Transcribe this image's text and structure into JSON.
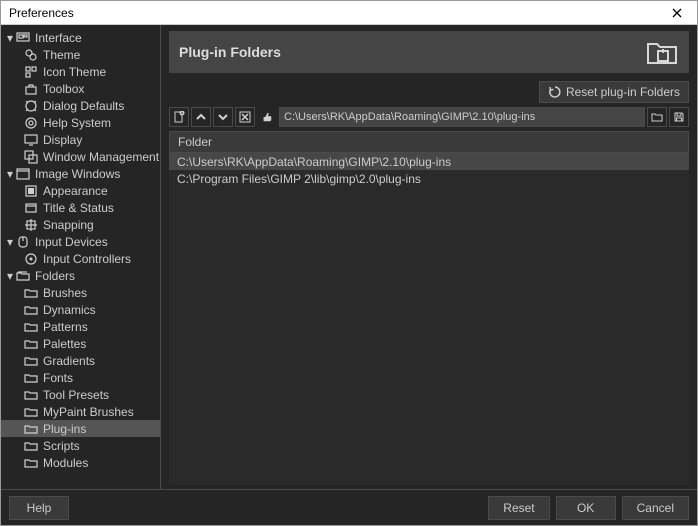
{
  "window": {
    "title": "Preferences"
  },
  "panel": {
    "title": "Plug-in Folders",
    "reset_plugin_folders": "Reset plug-in Folders"
  },
  "path_input": {
    "value": "C:\\Users\\RK\\AppData\\Roaming\\GIMP\\2.10\\plug-ins"
  },
  "folder_list": {
    "header": "Folder",
    "rows": [
      "C:\\Users\\RK\\AppData\\Roaming\\GIMP\\2.10\\plug-ins",
      "C:\\Program Files\\GIMP 2\\lib\\gimp\\2.0\\plug-ins"
    ],
    "selected": 0
  },
  "sidebar": {
    "items": [
      {
        "kind": "root",
        "label": "Interface",
        "icon": "interface",
        "expanded": true
      },
      {
        "kind": "child",
        "label": "Theme",
        "icon": "theme"
      },
      {
        "kind": "child",
        "label": "Icon Theme",
        "icon": "icon-theme"
      },
      {
        "kind": "child",
        "label": "Toolbox",
        "icon": "toolbox"
      },
      {
        "kind": "child",
        "label": "Dialog Defaults",
        "icon": "dialog-defaults"
      },
      {
        "kind": "child",
        "label": "Help System",
        "icon": "help"
      },
      {
        "kind": "child",
        "label": "Display",
        "icon": "display"
      },
      {
        "kind": "child",
        "label": "Window Management",
        "icon": "window-mgmt"
      },
      {
        "kind": "root",
        "label": "Image Windows",
        "icon": "image-windows",
        "expanded": true
      },
      {
        "kind": "child",
        "label": "Appearance",
        "icon": "appearance"
      },
      {
        "kind": "child",
        "label": "Title & Status",
        "icon": "title-status"
      },
      {
        "kind": "child",
        "label": "Snapping",
        "icon": "snapping"
      },
      {
        "kind": "root",
        "label": "Input Devices",
        "icon": "input-devices",
        "expanded": true
      },
      {
        "kind": "child",
        "label": "Input Controllers",
        "icon": "input-controllers"
      },
      {
        "kind": "root",
        "label": "Folders",
        "icon": "folders",
        "expanded": true
      },
      {
        "kind": "child",
        "label": "Brushes",
        "icon": "folder"
      },
      {
        "kind": "child",
        "label": "Dynamics",
        "icon": "folder"
      },
      {
        "kind": "child",
        "label": "Patterns",
        "icon": "folder"
      },
      {
        "kind": "child",
        "label": "Palettes",
        "icon": "folder"
      },
      {
        "kind": "child",
        "label": "Gradients",
        "icon": "folder"
      },
      {
        "kind": "child",
        "label": "Fonts",
        "icon": "folder"
      },
      {
        "kind": "child",
        "label": "Tool Presets",
        "icon": "folder"
      },
      {
        "kind": "child",
        "label": "MyPaint Brushes",
        "icon": "folder"
      },
      {
        "kind": "child",
        "label": "Plug-ins",
        "icon": "folder",
        "selected": true
      },
      {
        "kind": "child",
        "label": "Scripts",
        "icon": "folder"
      },
      {
        "kind": "child",
        "label": "Modules",
        "icon": "folder"
      }
    ]
  },
  "footer": {
    "help": "Help",
    "reset": "Reset",
    "ok": "OK",
    "cancel": "Cancel"
  }
}
